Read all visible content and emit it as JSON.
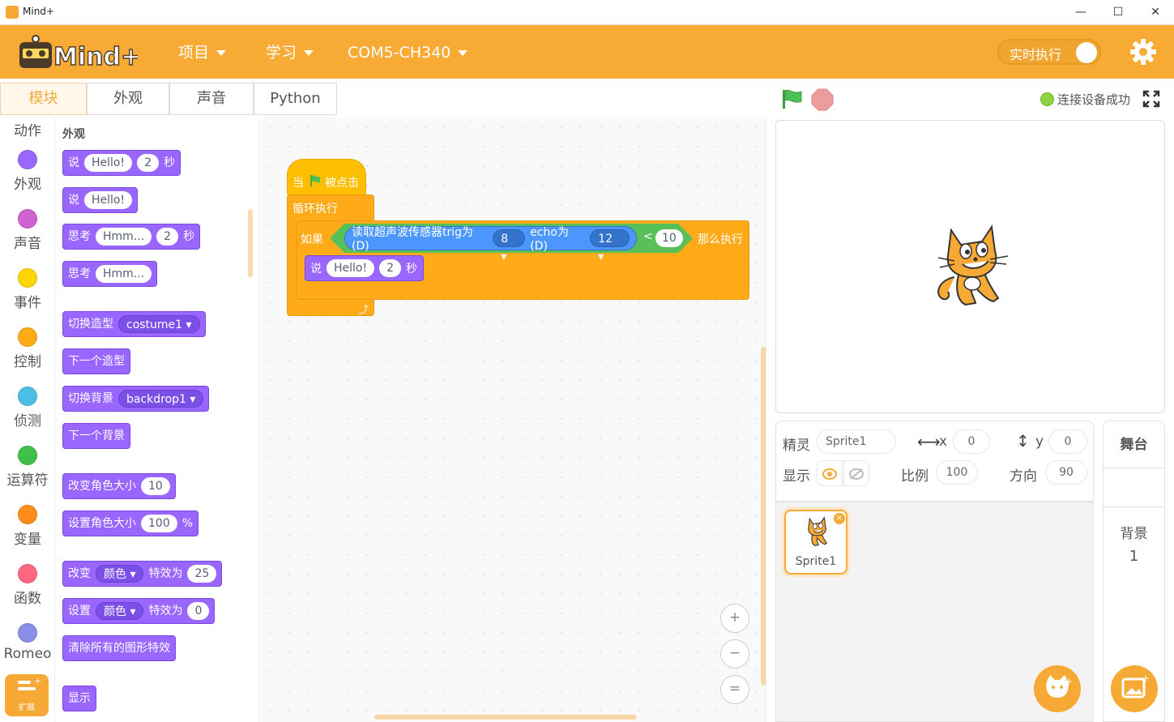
{
  "window": {
    "title": "Mind+",
    "minimize": "—",
    "maximize": "☐",
    "close": "✕"
  },
  "menubar": {
    "logo_text": "Mind+",
    "items": [
      {
        "label": "项目"
      },
      {
        "label": "学习"
      },
      {
        "label": "COM5-CH340"
      }
    ],
    "realtime_label": "实时执行",
    "colors": {
      "brand": "#f7ab35"
    }
  },
  "tabs": [
    {
      "label": "模块",
      "active": true
    },
    {
      "label": "外观"
    },
    {
      "label": "声音"
    },
    {
      "label": "Python"
    }
  ],
  "categories": [
    {
      "label": "动作",
      "color": "#4c97ff"
    },
    {
      "label": "外观",
      "color": "#9966ff"
    },
    {
      "label": "声音",
      "color": "#cf63cf"
    },
    {
      "label": "事件",
      "color": "#ffd500"
    },
    {
      "label": "控制",
      "color": "#ffab19"
    },
    {
      "label": "侦测",
      "color": "#4cbfe6"
    },
    {
      "label": "运算符",
      "color": "#40bf4a"
    },
    {
      "label": "变量",
      "color": "#ff8c1a"
    },
    {
      "label": "函数",
      "color": "#ff6680"
    },
    {
      "label": "Romeo",
      "color": "#8a8ee8"
    }
  ],
  "extension_label": "扩展",
  "palette": {
    "heading": "外观",
    "blocks": {
      "say_secs": {
        "verb": "说",
        "text": "Hello!",
        "secs": "2",
        "unit": "秒"
      },
      "say": {
        "verb": "说",
        "text": "Hello!"
      },
      "think_secs": {
        "verb": "思考",
        "text": "Hmm...",
        "secs": "2",
        "unit": "秒"
      },
      "think": {
        "verb": "思考",
        "text": "Hmm..."
      },
      "switch_costume": {
        "verb": "切换造型",
        "value": "costume1"
      },
      "next_costume": {
        "verb": "下一个造型"
      },
      "switch_backdrop": {
        "verb": "切换背景",
        "value": "backdrop1"
      },
      "next_backdrop": {
        "verb": "下一个背景"
      },
      "change_size": {
        "verb": "改变角色大小",
        "value": "10"
      },
      "set_size": {
        "verb": "设置角色大小",
        "value": "100",
        "unit": "%"
      },
      "change_effect": {
        "verb": "改变",
        "effect": "颜色",
        "mid": "特效为",
        "value": "25"
      },
      "set_effect": {
        "verb": "设置",
        "effect": "颜色",
        "mid": "特效为",
        "value": "0"
      },
      "clear_effects": {
        "verb": "清除所有的图形特效"
      },
      "show": {
        "verb": "显示"
      }
    }
  },
  "script": {
    "hat": {
      "when": "当",
      "clicked": "被点击"
    },
    "forever": "循环执行",
    "if": "如果",
    "then": "那么执行",
    "sensor": {
      "label": "读取超声波传感器trig为(D)",
      "trig": "8",
      "echo_label": "echo为(D)",
      "echo": "12"
    },
    "compare": {
      "op": "<",
      "value": "10"
    },
    "say": {
      "verb": "说",
      "text": "Hello!",
      "secs": "2",
      "unit": "秒"
    }
  },
  "zoom": {
    "in": "+",
    "out": "−",
    "reset": "="
  },
  "status": {
    "connection": "连接设备成功"
  },
  "sprite": {
    "label_sprite": "精灵",
    "name": "Sprite1",
    "label_x": "x",
    "x": "0",
    "label_y": "y",
    "y": "0",
    "label_show": "显示",
    "label_size": "比例",
    "size": "100",
    "label_direction": "方向",
    "direction": "90"
  },
  "sprite_list": [
    {
      "name": "Sprite1",
      "selected": true
    }
  ],
  "stage_pane": {
    "title": "舞台",
    "backdrop_label": "背景",
    "backdrop_count": "1"
  }
}
